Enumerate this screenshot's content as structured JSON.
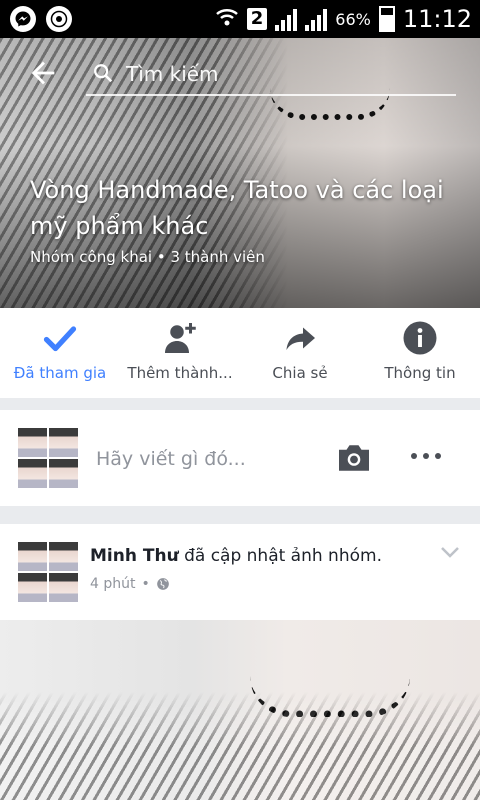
{
  "status_bar": {
    "icons": [
      "messenger-icon",
      "chrome-icon"
    ],
    "sim": "2",
    "battery_percent": "66%",
    "time": "11:12"
  },
  "header": {
    "search_placeholder": "Tìm kiếm"
  },
  "group": {
    "title": "Vòng Handmade, Tatoo và các loại mỹ phẩm khác",
    "subtitle": "Nhóm công khai • 3 thành viên"
  },
  "actions": [
    {
      "label": "Đã tham gia",
      "icon": "checkmark-icon",
      "active": true
    },
    {
      "label": "Thêm thành...",
      "icon": "add-member-icon",
      "active": false
    },
    {
      "label": "Chia sẻ",
      "icon": "share-icon",
      "active": false
    },
    {
      "label": "Thông tin",
      "icon": "info-icon",
      "active": false
    }
  ],
  "composer": {
    "placeholder": "Hãy viết gì đó..."
  },
  "post": {
    "author": "Minh Thư",
    "action": " đã cập nhật ảnh nhóm.",
    "time": "4 phút",
    "privacy_icon": "globe-icon"
  },
  "colors": {
    "accent": "#4080ff",
    "status_bar": "#000000",
    "background": "#e9ebee"
  }
}
